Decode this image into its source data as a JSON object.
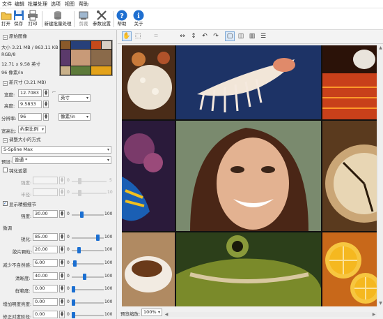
{
  "menu": [
    "文件",
    "编辑",
    "批量处理",
    "选项",
    "视图",
    "帮助"
  ],
  "toolbar": {
    "open": "打开",
    "save": "保存",
    "print": "打印",
    "batch": "新建批量处理",
    "crop": "剪裁",
    "settings": "参数设置",
    "help": "帮助",
    "about": "关于"
  },
  "original": {
    "section": "原始图像",
    "size": "大小 3.21 MB / 863.11 KB",
    "color": "RGB/8",
    "dimensions": "12.71 x 9.58 英寸",
    "resolution": "96 像素/in"
  },
  "new_size": {
    "section": "新尺寸 (3.21 MB)",
    "width_label": "宽度:",
    "width": "12.7083",
    "height_label": "高度:",
    "height": "9.5833",
    "unit": "英寸",
    "res_label": "分辨率:",
    "res": "96",
    "res_unit": "像素/in",
    "ratio_label": "宽高比:",
    "ratio": "约束比例"
  },
  "method": {
    "section": "调整大小的方式",
    "algorithm": "S-Spline Max",
    "preset_label": "预设:",
    "preset": "普通 *",
    "sharpen_check": "钝化遮罩",
    "strength_label": "强度:",
    "radius_label": "半径:",
    "max5": "5",
    "max10": "10",
    "zero": "0",
    "edge_check": "显示精细细节",
    "edge_strength_label": "强度:",
    "edge_strength": "30.00",
    "fine_section": "微调",
    "max100": "100",
    "sharpen_label": "锐化:",
    "sharpen": "85.00",
    "shadow_label": "胶片颗粒:",
    "shadow": "20.00",
    "noise_label": "减少不自然感:",
    "noise": "6.00",
    "clarity_label": "清晰度:",
    "clarity": "40.00",
    "fresh_label": "鲜艳度:",
    "fresh": "0.00",
    "bright_label": "增加明度亮度:",
    "bright": "0.00",
    "last_label": "修正对度阶段:",
    "last": "0.00"
  },
  "preview": {
    "zoom_label": "预览缩放:",
    "zoom": "100%"
  },
  "colors": {
    "accent": "#1b6fd1"
  },
  "slider_levels": {
    "edge_strength": 0.3,
    "sharpen": 0.85,
    "shadow": 0.2,
    "noise": 0.06,
    "clarity": 0.4,
    "fresh": 0.0,
    "bright": 0.0,
    "last": 0.0
  }
}
